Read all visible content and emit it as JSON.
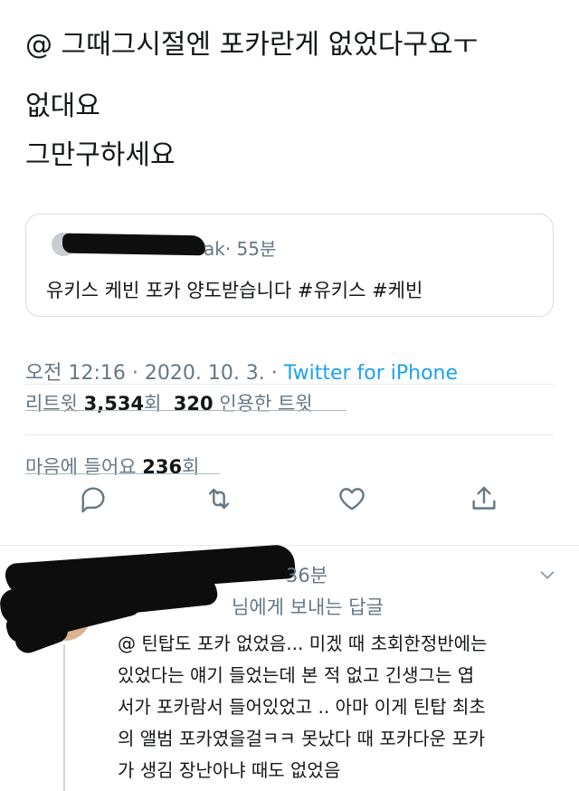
{
  "tweet": {
    "lines": [
      "@ 그때그시절엔 포카란게 없었다구요ㅜ",
      "없대요",
      "그만구하세요"
    ]
  },
  "quoted_tweet": {
    "handle_suffix": "ak",
    "time": "· 55분",
    "text": "유키스 케빈 포카 양도받습니다 #유키스 #케빈"
  },
  "meta": {
    "datetime": "오전 12:16 · 2020. 10. 3. ·",
    "client": "Twitter for iPhone"
  },
  "stats": {
    "retweet_label": "리트윗",
    "retweet_count": "3,534",
    "retweet_unit": "회",
    "quote_count": "320",
    "quote_label": "인용한 트윗",
    "like_label": "마음에 들어요",
    "like_count": "236",
    "like_unit": "회"
  },
  "actions": {
    "reply_icon": "reply-icon",
    "retweet_icon": "retweet-icon",
    "like_icon": "heart-icon",
    "share_icon": "share-icon"
  },
  "reply": {
    "time": "36분",
    "reply_to": "님에게 보내는 답글",
    "lines": [
      "@ 틴탑도 포카 없었음... 미겠 때 초회한정반에는",
      "있었다는 얘기 들었는데 본 적 없고 긴생그는 엽",
      "서가 포카람서 들어있었고 .. 아마 이게 틴탑 최초",
      "의 앨범 포카였을걸ㅋㅋ 못났다 때 포카다운 포카",
      "가 생김 장난아냐 때도 없었음"
    ]
  },
  "colors": {
    "text": "#14171a",
    "secondary": "#657786",
    "link": "#1da1f2",
    "border": "#d6dbe0"
  }
}
